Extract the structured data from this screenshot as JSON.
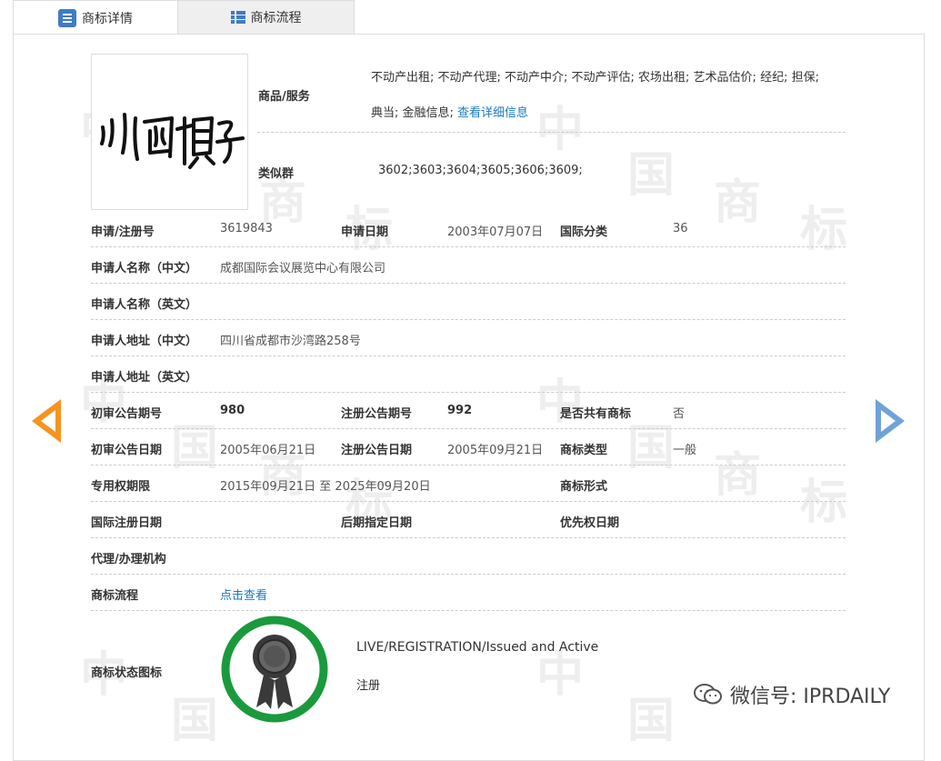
{
  "tabs": [
    {
      "label": "商标详情",
      "icon": "list-icon",
      "active": true
    },
    {
      "label": "商标流程",
      "icon": "grid-list-icon",
      "active": false
    }
  ],
  "watermark_chars": [
    "中",
    "国",
    "商",
    "标"
  ],
  "trademark": {
    "logo_text": "川西填子",
    "goods_services_label": "商品/服务",
    "goods_services_line1": "不动产出租; 不动产代理; 不动产中介; 不动产评估; 农场出租; 艺术品估价; 经纪; 担保;",
    "goods_services_line2": "典当; 金融信息;",
    "view_detail_link": "查看详细信息",
    "similar_group_label": "类似群",
    "similar_group_value": "3602;3603;3604;3605;3606;3609;"
  },
  "fields": {
    "reg_no_label": "申请/注册号",
    "reg_no": "3619843",
    "app_date_label": "申请日期",
    "app_date": "2003年07月07日",
    "intl_class_label": "国际分类",
    "intl_class": "36",
    "applicant_cn_label": "申请人名称（中文）",
    "applicant_cn": "成都国际会议展览中心有限公司",
    "applicant_en_label": "申请人名称（英文）",
    "applicant_en": "",
    "address_cn_label": "申请人地址（中文）",
    "address_cn": "四川省成都市沙湾路258号",
    "address_en_label": "申请人地址（英文）",
    "address_en": "",
    "prelim_pub_no_label": "初审公告期号",
    "prelim_pub_no": "980",
    "reg_pub_no_label": "注册公告期号",
    "reg_pub_no": "992",
    "shared_label": "是否共有商标",
    "shared": "否",
    "prelim_pub_date_label": "初审公告日期",
    "prelim_pub_date": "2005年06月21日",
    "reg_pub_date_label": "注册公告日期",
    "reg_pub_date": "2005年09月21日",
    "tm_type_label": "商标类型",
    "tm_type": "一般",
    "exclusive_period_label": "专用权期限",
    "exclusive_period": "2015年09月21日 至 2025年09月20日",
    "tm_form_label": "商标形式",
    "tm_form": "",
    "intl_reg_date_label": "国际注册日期",
    "intl_reg_date": "",
    "later_designation_label": "后期指定日期",
    "later_designation": "",
    "priority_date_label": "优先权日期",
    "priority_date": "",
    "agent_label": "代理/办理机构",
    "agent": "",
    "process_label": "商标流程",
    "process_link": "点击查看",
    "status_icon_label": "商标状态图标",
    "status_en": "LIVE/REGISTRATION/Issued and Active",
    "status_cn": "注册"
  },
  "wechat": {
    "text": "微信号: IPRDAILY",
    "icon": "wechat-icon"
  },
  "colors": {
    "accent_blue": "#3f7cc4",
    "link_blue": "#1a7ac0",
    "arrow_orange": "#f7931e",
    "arrow_blue": "#6ea3d8",
    "badge_green": "#1a9a3c"
  }
}
